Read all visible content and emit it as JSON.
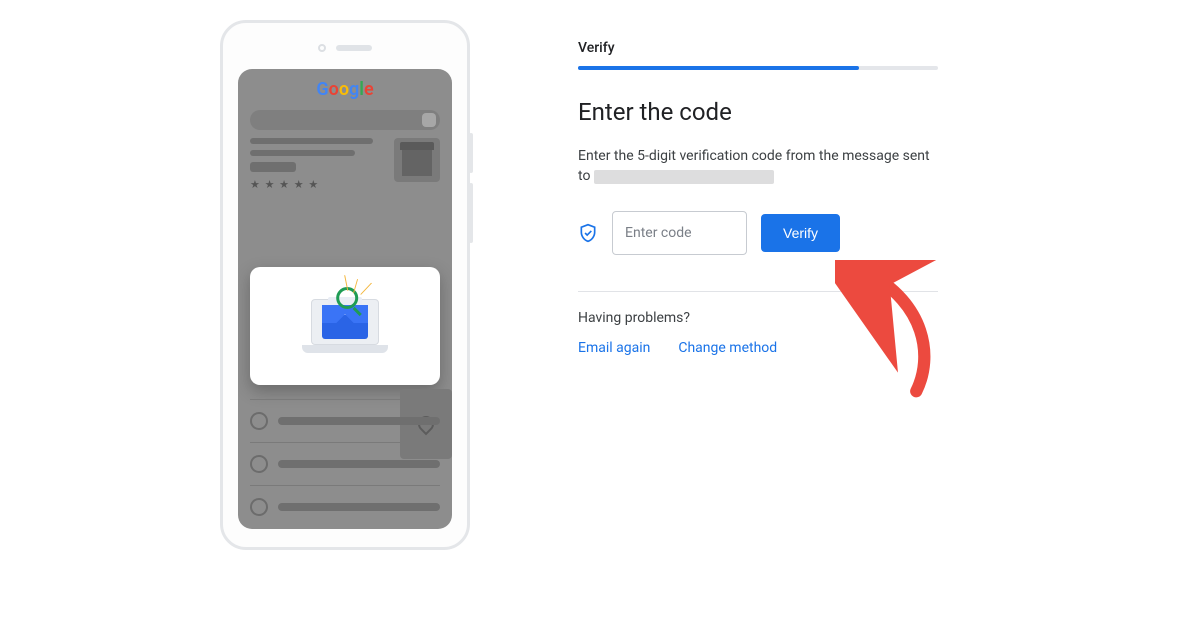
{
  "logo_letters": [
    "G",
    "o",
    "o",
    "g",
    "l",
    "e"
  ],
  "verify": {
    "step_label": "Verify",
    "title": "Enter the code",
    "instruction": "Enter the 5-digit verification code from the message sent to",
    "input_placeholder": "Enter code",
    "button_label": "Verify",
    "having_problems": "Having problems?",
    "email_again": "Email again",
    "change_method": "Change method"
  }
}
